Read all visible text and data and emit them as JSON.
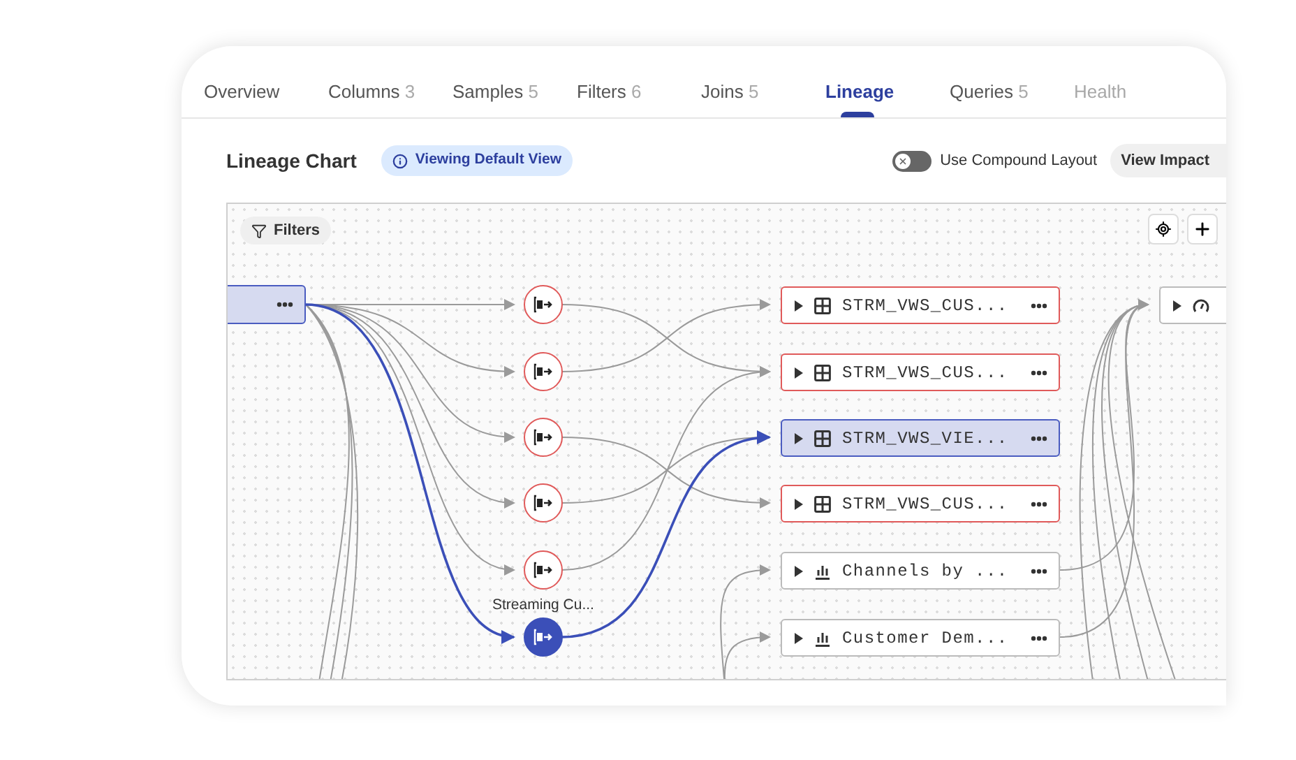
{
  "tabs": [
    {
      "label": "Overview",
      "selected": false,
      "disabled": false
    },
    {
      "label": "Columns",
      "count": "3",
      "selected": false,
      "disabled": false
    },
    {
      "label": "Samples",
      "count": "5",
      "selected": false,
      "disabled": false
    },
    {
      "label": "Filters",
      "count": "6",
      "selected": false,
      "disabled": false
    },
    {
      "label": "Joins",
      "count": "5",
      "selected": false,
      "disabled": false
    },
    {
      "label": "Lineage",
      "selected": true,
      "disabled": false
    },
    {
      "label": "Queries",
      "count": "5",
      "selected": false,
      "disabled": false
    },
    {
      "label": "Health",
      "selected": false,
      "disabled": true
    }
  ],
  "header": {
    "title": "Lineage Chart",
    "badge": "Viewing Default View",
    "toggle": {
      "label": "Use Compound Layout",
      "on": false
    },
    "action_button": "View Impact"
  },
  "canvas": {
    "filters_button": "Filters",
    "source_node": {
      "selected": true
    },
    "transform_nodes": [
      {
        "flagged": true,
        "selected": false
      },
      {
        "flagged": true,
        "selected": false
      },
      {
        "flagged": true,
        "selected": false
      },
      {
        "flagged": true,
        "selected": false
      },
      {
        "flagged": true,
        "selected": false
      },
      {
        "selected": true,
        "label": "Streaming Cu..."
      }
    ],
    "dataset_nodes": [
      {
        "kind": "table",
        "label": "STRM_VWS_CUS...",
        "flagged": true,
        "selected": false
      },
      {
        "kind": "table",
        "label": "STRM_VWS_CUS...",
        "flagged": true,
        "selected": false
      },
      {
        "kind": "table",
        "label": "STRM_VWS_VIE...",
        "selected": true
      },
      {
        "kind": "table",
        "label": "STRM_VWS_CUS...",
        "flagged": true,
        "selected": false
      },
      {
        "kind": "chart",
        "label": "Channels by ...",
        "flagged": false,
        "selected": false
      },
      {
        "kind": "chart",
        "label": "Customer Dem...",
        "flagged": false,
        "selected": false
      }
    ],
    "dashboard_node": {
      "selected": false
    }
  }
}
